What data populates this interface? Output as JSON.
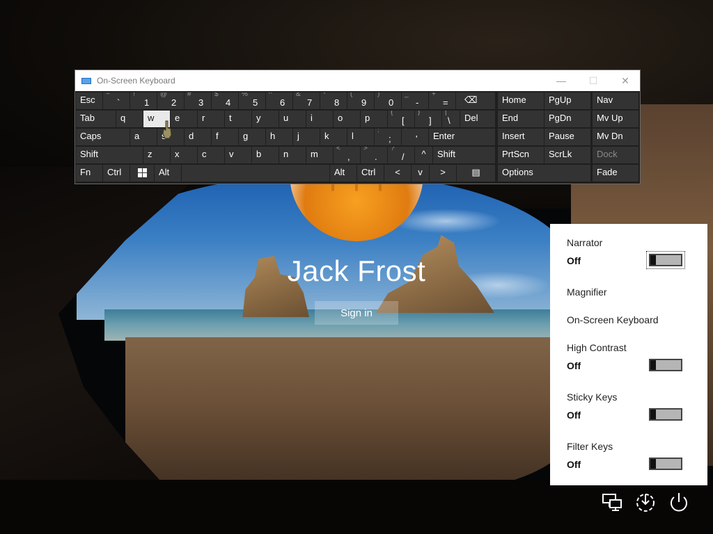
{
  "user": {
    "name": "Jack Frost",
    "signin_label": "Sign in"
  },
  "osk": {
    "title": "On-Screen Keyboard",
    "window_controls": {
      "minimize": "—",
      "maximize": "☐",
      "close": "✕"
    },
    "row1": [
      {
        "label": "Esc"
      },
      {
        "sub": "~",
        "main": "`"
      },
      {
        "sub": "!",
        "main": "1"
      },
      {
        "sub": "@",
        "main": "2"
      },
      {
        "sub": "#",
        "main": "3"
      },
      {
        "sub": "$",
        "main": "4"
      },
      {
        "sub": "%",
        "main": "5"
      },
      {
        "sub": "^",
        "main": "6"
      },
      {
        "sub": "&",
        "main": "7"
      },
      {
        "sub": "*",
        "main": "8"
      },
      {
        "sub": "(",
        "main": "9"
      },
      {
        "sub": ")",
        "main": "0"
      },
      {
        "sub": "_",
        "main": "-"
      },
      {
        "sub": "+",
        "main": "="
      },
      {
        "label": "⌫"
      }
    ],
    "row2": [
      "Tab",
      "q",
      "w",
      "e",
      "r",
      "t",
      "y",
      "u",
      "i",
      "o",
      "p",
      "{",
      "[",
      "}",
      "]",
      "|",
      "\\",
      "Del"
    ],
    "row3": [
      "Caps",
      "a",
      "s",
      "d",
      "f",
      "g",
      "h",
      "j",
      "k",
      "l",
      ":",
      ";",
      "\"",
      "'",
      "Enter"
    ],
    "row4": [
      "Shift",
      "z",
      "x",
      "c",
      "v",
      "b",
      "n",
      "m",
      "<",
      ",",
      ">",
      ".",
      "?",
      "/",
      "^",
      "Shift"
    ],
    "row5": [
      "Fn",
      "Ctrl",
      "⊞",
      "Alt",
      "Alt",
      "Ctrl",
      "<",
      "v",
      ">",
      "▤"
    ],
    "nav": [
      [
        "Home",
        "PgUp",
        "Nav"
      ],
      [
        "End",
        "PgDn",
        "Mv Up"
      ],
      [
        "Insert",
        "Pause",
        "Mv Dn"
      ],
      [
        "PrtScn",
        "ScrLk",
        "Dock"
      ],
      [
        "Options",
        "Fade"
      ]
    ]
  },
  "ease_of_access": {
    "narrator": {
      "label": "Narrator",
      "state": "Off"
    },
    "magnifier": {
      "label": "Magnifier"
    },
    "osk": {
      "label": "On-Screen Keyboard"
    },
    "high_contrast": {
      "label": "High Contrast",
      "state": "Off"
    },
    "sticky_keys": {
      "label": "Sticky Keys",
      "state": "Off"
    },
    "filter_keys": {
      "label": "Filter Keys",
      "state": "Off"
    }
  },
  "system_icons": [
    "network-icon",
    "ease-of-access-icon",
    "power-icon"
  ],
  "colors": {
    "osk_bg": "#1f1f1f",
    "key_bg": "#333333",
    "active_key": "#e9e9e9",
    "panel_bg": "#ffffff"
  }
}
